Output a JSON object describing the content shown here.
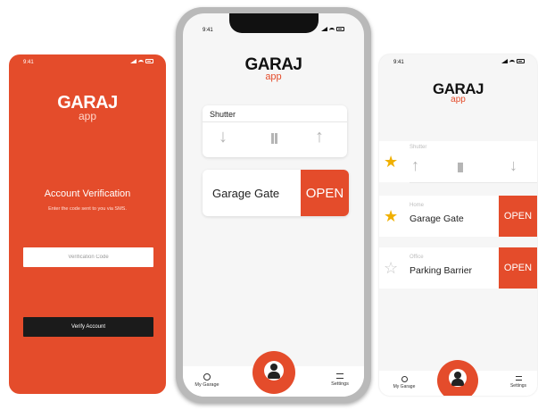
{
  "brand": {
    "name": "GARAJ",
    "sub": "app",
    "accent": "#e44c2b",
    "dark": "#1b1b1b",
    "star": "#f0b000"
  },
  "status": {
    "time": "9:41"
  },
  "verification": {
    "title": "Account Verification",
    "subtitle": "Enter the code sent to you via SMS.",
    "code_placeholder": "Verification Code",
    "verify_button": "Verify Account"
  },
  "home": {
    "shutter": {
      "title": "Shutter",
      "icons": [
        "arrow-down-icon",
        "pause-icon",
        "arrow-up-icon"
      ]
    },
    "gate": {
      "label": "Garage Gate",
      "open": "OPEN"
    }
  },
  "tabbar": {
    "my_garage": "My Garage",
    "settings": "Settings",
    "icons": [
      "gear-icon",
      "user-icon",
      "sliders-icon"
    ]
  },
  "favorites": {
    "shutter": {
      "category": "Shutter",
      "starred": true
    },
    "garage_gate": {
      "category": "Home",
      "label": "Garage Gate",
      "open": "OPEN",
      "starred": true
    },
    "parking_barrier": {
      "category": "Office",
      "label": "Parking Barrier",
      "open": "OPEN",
      "starred": false
    }
  }
}
